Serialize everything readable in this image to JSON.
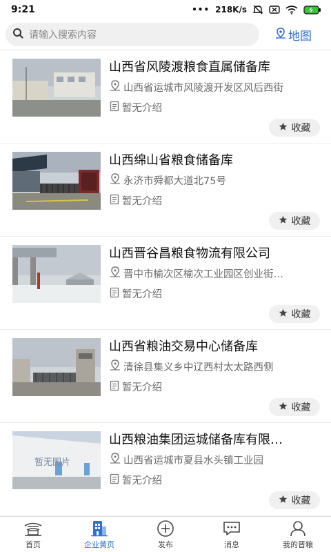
{
  "status_bar": {
    "time": "9:21",
    "network_speed": "218K/s"
  },
  "search": {
    "placeholder": "请输入搜索内容",
    "map_label": "地图"
  },
  "colors": {
    "accent": "#2f6fd6",
    "nav_active": "#2f6fd6"
  },
  "cards": [
    {
      "title": "山西省风陵渡粮食直属储备库",
      "address": "山西省运城市风陵渡开发区风后西街",
      "intro": "暂无介绍",
      "fav_label": "收藏"
    },
    {
      "title": "山西绵山省粮食储备库",
      "address": "永济市舜都大道北75号",
      "intro": "暂无介绍",
      "fav_label": "收藏"
    },
    {
      "title": "山西晋谷昌粮食物流有限公司",
      "address": "晋中市榆次区榆次工业园区创业街…",
      "intro": "暂无介绍",
      "fav_label": "收藏"
    },
    {
      "title": "山西省粮油交易中心储备库",
      "address": "清徐县集义乡中辽西村太太路西侧",
      "intro": "暂无介绍",
      "fav_label": "收藏"
    },
    {
      "title": "山西粮油集团运城储备库有限…",
      "address": "山西省运城市夏县水头镇工业园",
      "intro": "暂无介绍",
      "fav_label": "收藏",
      "image_placeholder": "暂无图片"
    }
  ],
  "bottom_nav": [
    {
      "label": "首页",
      "icon": "home-pavilion-icon"
    },
    {
      "label": "企业黄页",
      "icon": "enterprise-directory-icon",
      "active": true
    },
    {
      "label": "发布",
      "icon": "plus-circle-icon"
    },
    {
      "label": "消息",
      "icon": "message-icon"
    },
    {
      "label": "我的晋粮",
      "icon": "user-icon"
    }
  ]
}
